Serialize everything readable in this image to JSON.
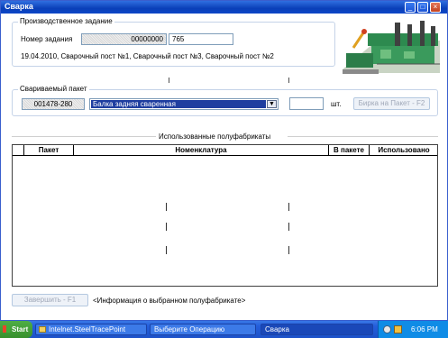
{
  "window": {
    "title": "Сварка"
  },
  "task": {
    "legend": "Производственное задание",
    "number_label": "Номер задания",
    "number_value": "00000000",
    "number_suffix": "765",
    "info": "19.04.2010, Сварочный пост №1, Сварочный пост №3, Сварочный пост №2"
  },
  "package": {
    "legend": "Свариваемый пакет",
    "code": "001478-280",
    "item": "Балка задняя сваренная",
    "qty": "",
    "qty_unit": "шт.",
    "tag_button": "Бирка на Пакет - F2"
  },
  "semi": {
    "legend": "Использованные полуфабрикаты",
    "columns": [
      "Пакет",
      "Номенклатура",
      "В пакете",
      "Использовано"
    ]
  },
  "footer": {
    "finish_button": "Завершить - F1",
    "info": "<Информация о выбранном полуфабрикате>"
  },
  "taskbar": {
    "start": "Start",
    "items": [
      "Intelnet.SteelTracePoint",
      "Выберите Операцию",
      "Сварка"
    ],
    "clock": "6:06 PM"
  }
}
